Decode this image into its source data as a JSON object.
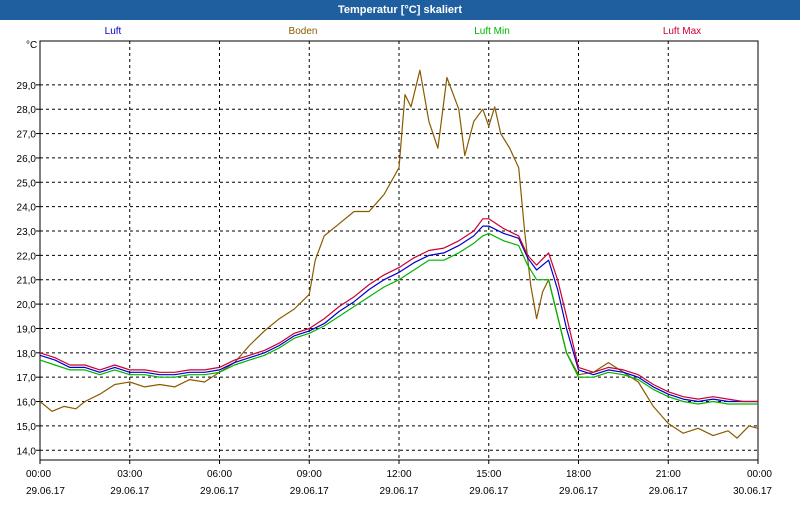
{
  "window": {
    "title": "Temperatur [°C] skaliert"
  },
  "chart_data": {
    "type": "line",
    "title": "Temperatur [°C] skaliert",
    "ylabel": "°C",
    "xlabel": "",
    "ylim": [
      13.6,
      30.8
    ],
    "xlim": [
      0,
      24
    ],
    "yticks": [
      14,
      15,
      16,
      17,
      18,
      19,
      20,
      21,
      22,
      23,
      24,
      25,
      26,
      27,
      28,
      29
    ],
    "ytick_labels": [
      "14,0",
      "15,0",
      "16,0",
      "17,0",
      "18,0",
      "19,0",
      "20,0",
      "21,0",
      "22,0",
      "23,0",
      "24,0",
      "25,0",
      "26,0",
      "27,0",
      "28,0",
      "29,0"
    ],
    "xticks": [
      0,
      3,
      6,
      9,
      12,
      15,
      18,
      21,
      24
    ],
    "xtick_time_labels": [
      "00:00",
      "03:00",
      "06:00",
      "09:00",
      "12:00",
      "15:00",
      "18:00",
      "21:00",
      "00:00"
    ],
    "xtick_date_labels": [
      "29.06.17",
      "29.06.17",
      "29.06.17",
      "29.06.17",
      "29.06.17",
      "29.06.17",
      "29.06.17",
      "29.06.17",
      "30.06.17"
    ],
    "grid": true,
    "legend_position": "top",
    "series": [
      {
        "name": "Luft",
        "color": "#0000cc",
        "points": [
          [
            0,
            17.9
          ],
          [
            0.5,
            17.7
          ],
          [
            1,
            17.4
          ],
          [
            1.5,
            17.4
          ],
          [
            2,
            17.2
          ],
          [
            2.5,
            17.4
          ],
          [
            3,
            17.2
          ],
          [
            3.5,
            17.2
          ],
          [
            4,
            17.1
          ],
          [
            4.5,
            17.1
          ],
          [
            5,
            17.2
          ],
          [
            5.5,
            17.2
          ],
          [
            6,
            17.3
          ],
          [
            6.5,
            17.6
          ],
          [
            7,
            17.8
          ],
          [
            7.5,
            18.0
          ],
          [
            8,
            18.3
          ],
          [
            8.5,
            18.7
          ],
          [
            9,
            18.9
          ],
          [
            9.5,
            19.2
          ],
          [
            10,
            19.7
          ],
          [
            10.5,
            20.1
          ],
          [
            11,
            20.6
          ],
          [
            11.5,
            21.0
          ],
          [
            12,
            21.3
          ],
          [
            12.5,
            21.7
          ],
          [
            13,
            22.0
          ],
          [
            13.5,
            22.1
          ],
          [
            14,
            22.4
          ],
          [
            14.5,
            22.8
          ],
          [
            14.8,
            23.2
          ],
          [
            15,
            23.2
          ],
          [
            15.5,
            22.9
          ],
          [
            16,
            22.7
          ],
          [
            16.3,
            21.9
          ],
          [
            16.6,
            21.4
          ],
          [
            17,
            21.8
          ],
          [
            17.3,
            20.6
          ],
          [
            17.6,
            19.0
          ],
          [
            18,
            17.3
          ],
          [
            18.5,
            17.1
          ],
          [
            19,
            17.3
          ],
          [
            19.5,
            17.2
          ],
          [
            20,
            17.0
          ],
          [
            20.5,
            16.6
          ],
          [
            21,
            16.3
          ],
          [
            21.5,
            16.1
          ],
          [
            22,
            16.0
          ],
          [
            22.5,
            16.1
          ],
          [
            23,
            16.0
          ],
          [
            23.5,
            16.0
          ],
          [
            24,
            16.0
          ]
        ]
      },
      {
        "name": "Boden",
        "color": "#8b5a00",
        "points": [
          [
            0,
            16.0
          ],
          [
            0.4,
            15.6
          ],
          [
            0.8,
            15.8
          ],
          [
            1.2,
            15.7
          ],
          [
            1.5,
            16.0
          ],
          [
            2,
            16.3
          ],
          [
            2.5,
            16.7
          ],
          [
            3,
            16.8
          ],
          [
            3.5,
            16.6
          ],
          [
            4,
            16.7
          ],
          [
            4.5,
            16.6
          ],
          [
            5,
            16.9
          ],
          [
            5.5,
            16.8
          ],
          [
            6,
            17.2
          ],
          [
            6.5,
            17.6
          ],
          [
            7,
            18.3
          ],
          [
            7.5,
            18.9
          ],
          [
            8,
            19.4
          ],
          [
            8.5,
            19.8
          ],
          [
            9,
            20.4
          ],
          [
            9.2,
            21.8
          ],
          [
            9.5,
            22.8
          ],
          [
            10,
            23.3
          ],
          [
            10.5,
            23.8
          ],
          [
            11,
            23.8
          ],
          [
            11.5,
            24.5
          ],
          [
            12,
            25.6
          ],
          [
            12.2,
            28.6
          ],
          [
            12.4,
            28.1
          ],
          [
            12.7,
            29.6
          ],
          [
            13,
            27.5
          ],
          [
            13.3,
            26.4
          ],
          [
            13.6,
            29.3
          ],
          [
            14,
            28.0
          ],
          [
            14.2,
            26.1
          ],
          [
            14.5,
            27.5
          ],
          [
            14.8,
            28.0
          ],
          [
            15,
            27.3
          ],
          [
            15.2,
            28.1
          ],
          [
            15.4,
            27.0
          ],
          [
            15.7,
            26.4
          ],
          [
            16,
            25.6
          ],
          [
            16.2,
            23.0
          ],
          [
            16.4,
            20.8
          ],
          [
            16.6,
            19.4
          ],
          [
            16.8,
            20.5
          ],
          [
            17,
            21.0
          ],
          [
            17.3,
            19.5
          ],
          [
            17.6,
            18.0
          ],
          [
            18,
            17.1
          ],
          [
            18.5,
            17.2
          ],
          [
            19,
            17.6
          ],
          [
            19.5,
            17.2
          ],
          [
            20,
            16.8
          ],
          [
            20.5,
            15.8
          ],
          [
            21,
            15.1
          ],
          [
            21.5,
            14.7
          ],
          [
            22,
            14.9
          ],
          [
            22.5,
            14.6
          ],
          [
            23,
            14.8
          ],
          [
            23.3,
            14.5
          ],
          [
            23.7,
            15.0
          ],
          [
            24,
            14.9
          ]
        ]
      },
      {
        "name": "Luft Min",
        "color": "#00b400",
        "points": [
          [
            0,
            17.7
          ],
          [
            0.5,
            17.5
          ],
          [
            1,
            17.3
          ],
          [
            1.5,
            17.3
          ],
          [
            2,
            17.1
          ],
          [
            2.5,
            17.3
          ],
          [
            3,
            17.1
          ],
          [
            3.5,
            17.1
          ],
          [
            4,
            17.0
          ],
          [
            4.5,
            17.0
          ],
          [
            5,
            17.1
          ],
          [
            5.5,
            17.1
          ],
          [
            6,
            17.2
          ],
          [
            6.5,
            17.5
          ],
          [
            7,
            17.7
          ],
          [
            7.5,
            17.9
          ],
          [
            8,
            18.2
          ],
          [
            8.5,
            18.6
          ],
          [
            9,
            18.8
          ],
          [
            9.5,
            19.1
          ],
          [
            10,
            19.5
          ],
          [
            10.5,
            19.9
          ],
          [
            11,
            20.3
          ],
          [
            11.5,
            20.7
          ],
          [
            12,
            21.0
          ],
          [
            12.5,
            21.4
          ],
          [
            13,
            21.8
          ],
          [
            13.5,
            21.8
          ],
          [
            14,
            22.1
          ],
          [
            14.5,
            22.5
          ],
          [
            14.8,
            22.8
          ],
          [
            15,
            22.9
          ],
          [
            15.5,
            22.6
          ],
          [
            16,
            22.4
          ],
          [
            16.3,
            21.6
          ],
          [
            16.6,
            21.0
          ],
          [
            17,
            21.0
          ],
          [
            17.3,
            19.5
          ],
          [
            17.6,
            18.0
          ],
          [
            18,
            17.0
          ],
          [
            18.5,
            17.0
          ],
          [
            19,
            17.2
          ],
          [
            19.5,
            17.1
          ],
          [
            20,
            16.9
          ],
          [
            20.5,
            16.5
          ],
          [
            21,
            16.2
          ],
          [
            21.5,
            16.0
          ],
          [
            22,
            15.9
          ],
          [
            22.5,
            16.0
          ],
          [
            23,
            15.9
          ],
          [
            23.5,
            15.9
          ],
          [
            24,
            15.9
          ]
        ]
      },
      {
        "name": "Luft Max",
        "color": "#cc0033",
        "points": [
          [
            0,
            18.0
          ],
          [
            0.5,
            17.8
          ],
          [
            1,
            17.5
          ],
          [
            1.5,
            17.5
          ],
          [
            2,
            17.3
          ],
          [
            2.5,
            17.5
          ],
          [
            3,
            17.3
          ],
          [
            3.5,
            17.3
          ],
          [
            4,
            17.2
          ],
          [
            4.5,
            17.2
          ],
          [
            5,
            17.3
          ],
          [
            5.5,
            17.3
          ],
          [
            6,
            17.4
          ],
          [
            6.5,
            17.7
          ],
          [
            7,
            17.9
          ],
          [
            7.5,
            18.1
          ],
          [
            8,
            18.4
          ],
          [
            8.5,
            18.8
          ],
          [
            9,
            19.0
          ],
          [
            9.5,
            19.4
          ],
          [
            10,
            19.9
          ],
          [
            10.5,
            20.3
          ],
          [
            11,
            20.8
          ],
          [
            11.5,
            21.2
          ],
          [
            12,
            21.5
          ],
          [
            12.5,
            21.9
          ],
          [
            13,
            22.2
          ],
          [
            13.5,
            22.3
          ],
          [
            14,
            22.6
          ],
          [
            14.5,
            23.0
          ],
          [
            14.8,
            23.5
          ],
          [
            15,
            23.5
          ],
          [
            15.5,
            23.1
          ],
          [
            16,
            22.8
          ],
          [
            16.3,
            22.0
          ],
          [
            16.6,
            21.6
          ],
          [
            17,
            22.1
          ],
          [
            17.3,
            21.0
          ],
          [
            17.6,
            19.5
          ],
          [
            18,
            17.4
          ],
          [
            18.5,
            17.2
          ],
          [
            19,
            17.4
          ],
          [
            19.5,
            17.3
          ],
          [
            20,
            17.1
          ],
          [
            20.5,
            16.7
          ],
          [
            21,
            16.4
          ],
          [
            21.5,
            16.2
          ],
          [
            22,
            16.1
          ],
          [
            22.5,
            16.2
          ],
          [
            23,
            16.1
          ],
          [
            23.5,
            16.0
          ],
          [
            24,
            16.0
          ]
        ]
      }
    ]
  }
}
